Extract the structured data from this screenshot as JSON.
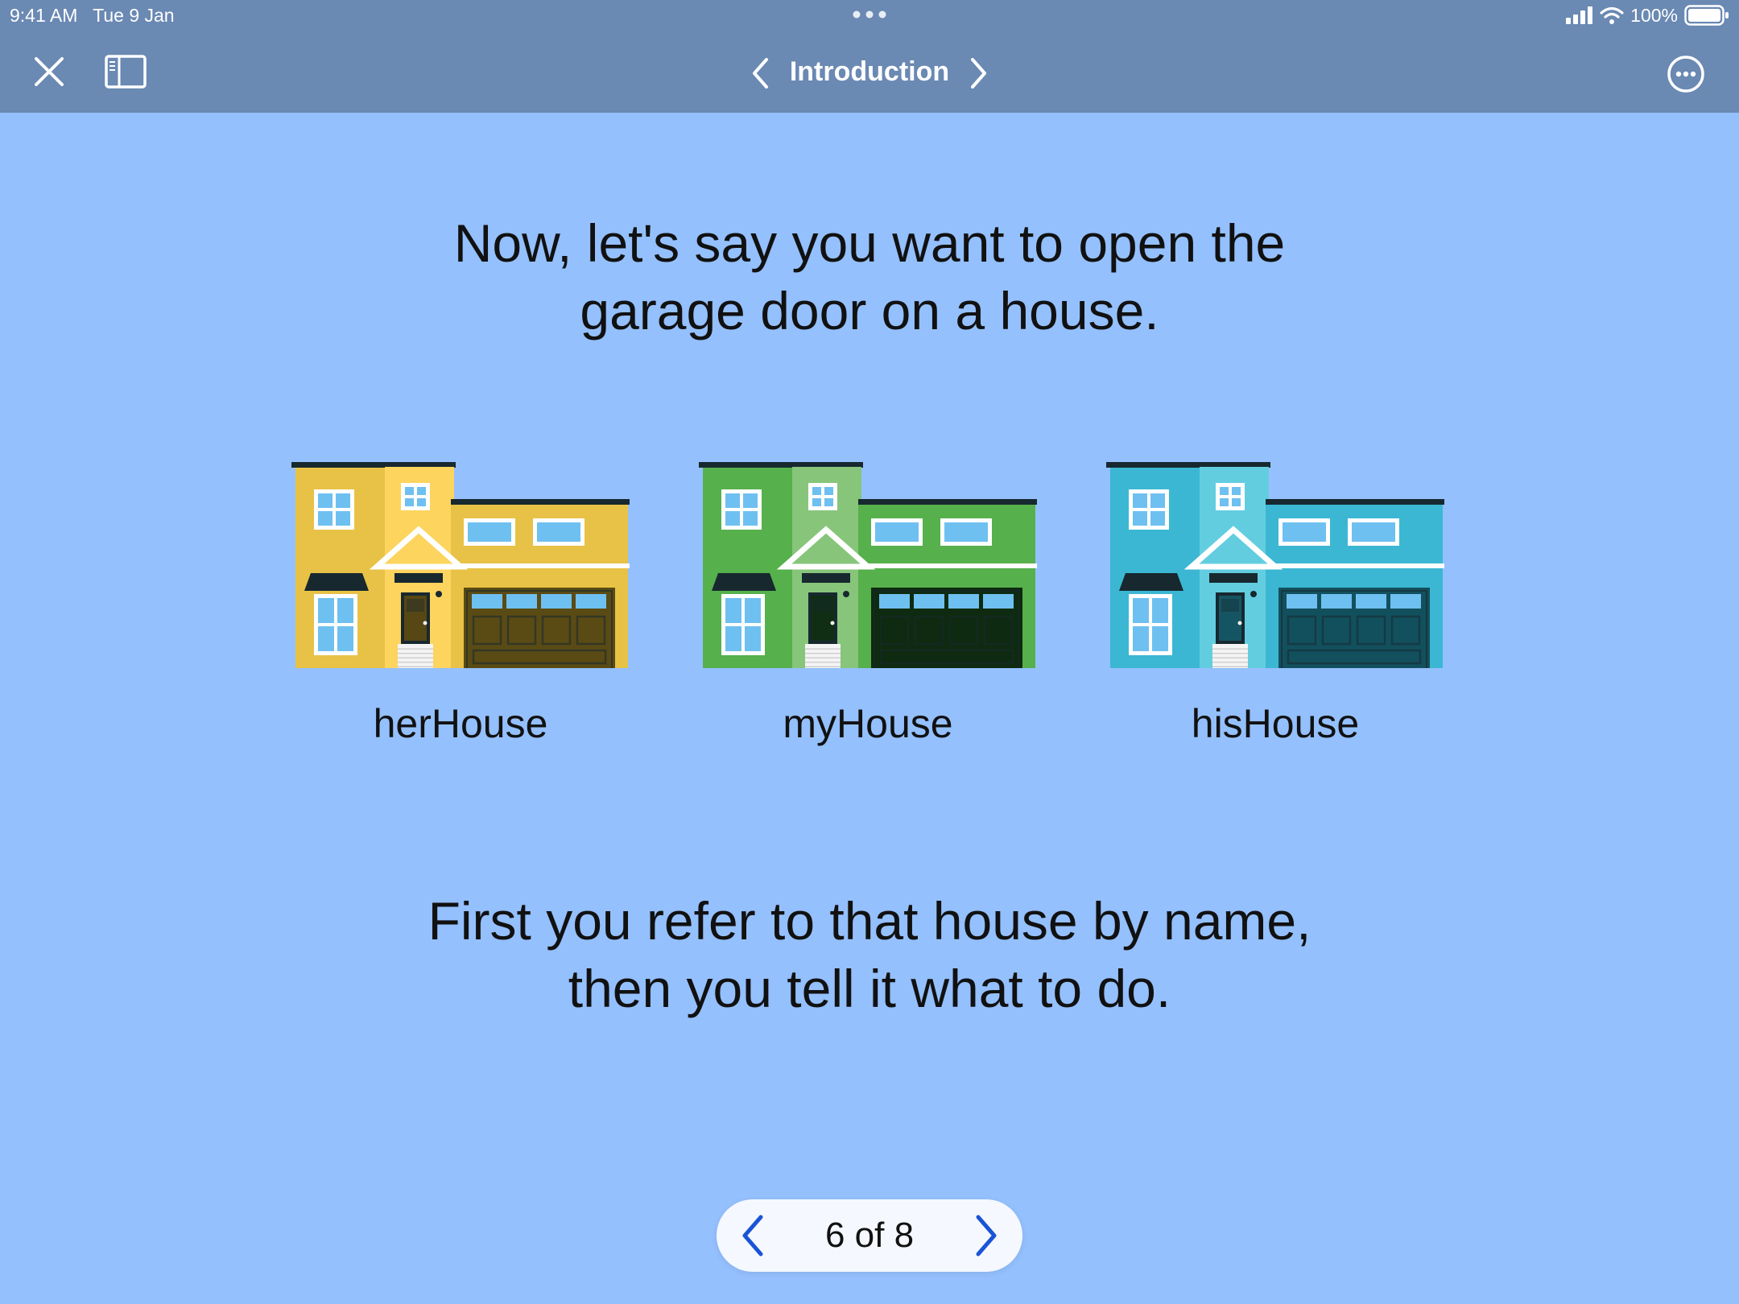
{
  "status_bar": {
    "time": "9:41 AM",
    "date": "Tue 9 Jan",
    "battery": "100%",
    "icons": [
      "signal-icon",
      "wifi-icon",
      "battery-icon"
    ]
  },
  "nav": {
    "title": "Introduction",
    "icons": [
      "close-icon",
      "sidebar-icon",
      "chevron-left-icon",
      "chevron-right-icon",
      "more-icon"
    ]
  },
  "content": {
    "headline_line1": "Now, let's say you want to open the",
    "headline_line2": "garage door on a house.",
    "footer_line1": "First you refer to that house by name,",
    "footer_line2": "then you tell it what to do."
  },
  "houses": [
    {
      "label": "herHouse",
      "color_main": "#e8c246",
      "color_tower": "#fcd45e",
      "color_door": "#574714",
      "color_garage": "#5a4b14"
    },
    {
      "label": "myHouse",
      "color_main": "#56b04c",
      "color_tower": "#87c57b",
      "color_door": "#0f2e14",
      "color_garage": "#0e2a10"
    },
    {
      "label": "hisHouse",
      "color_main": "#3bb7d3",
      "color_tower": "#63cde0",
      "color_door": "#155563",
      "color_garage": "#13505e"
    }
  ],
  "pager": {
    "text": "6 of 8"
  },
  "colors": {
    "bar": "#6a89b3",
    "background": "#94c0fd",
    "accent": "#1a54d6"
  }
}
